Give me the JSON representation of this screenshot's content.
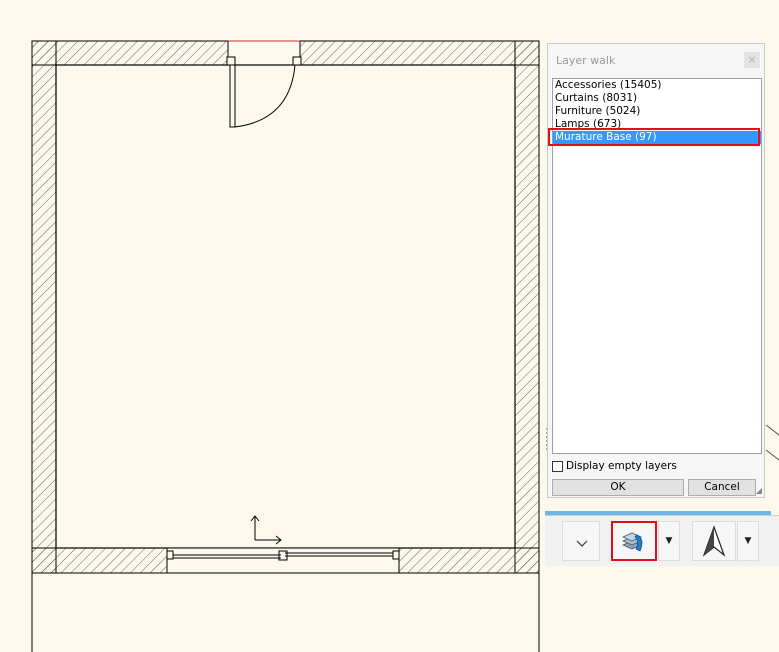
{
  "dialog": {
    "title": "Layer walk",
    "close_label": "×",
    "layers": [
      {
        "label": "Accessories (15405)",
        "selected": false
      },
      {
        "label": "Curtains (8031)",
        "selected": false
      },
      {
        "label": "Furniture (5024)",
        "selected": false
      },
      {
        "label": "Lamps (673)",
        "selected": false
      },
      {
        "label": "Murature Base (97)",
        "selected": true
      }
    ],
    "display_empty_layers": {
      "label": "Display empty layers",
      "checked": false
    },
    "ok_label": "OK",
    "cancel_label": "Cancel"
  },
  "toolbar": {
    "buttons": [
      {
        "name": "view-dropdown",
        "icon": "chevron-down-icon"
      },
      {
        "name": "layer-walk",
        "icon": "layers-icon"
      },
      {
        "name": "layer-walk-menu",
        "icon": "caret-down-icon"
      },
      {
        "name": "north-arrow",
        "icon": "north-arrow-icon"
      },
      {
        "name": "north-arrow-menu",
        "icon": "caret-down-icon"
      }
    ]
  },
  "colors": {
    "background": "#fdf8ec",
    "selection": "#3399ff",
    "highlight": "#e0101a",
    "accent": "#70b4e6"
  }
}
